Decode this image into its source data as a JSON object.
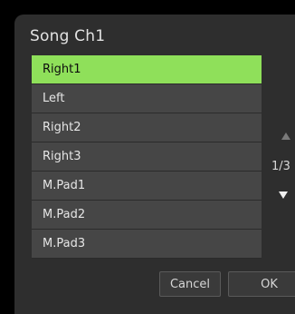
{
  "dialog": {
    "title": "Song Ch1",
    "items": [
      {
        "label": "Right1",
        "selected": true
      },
      {
        "label": "Left",
        "selected": false
      },
      {
        "label": "Right2",
        "selected": false
      },
      {
        "label": "Right3",
        "selected": false
      },
      {
        "label": "M.Pad1",
        "selected": false
      },
      {
        "label": "M.Pad2",
        "selected": false
      },
      {
        "label": "M.Pad3",
        "selected": false
      }
    ],
    "page_indicator": "1/3",
    "cancel_label": "Cancel",
    "ok_label": "OK"
  },
  "colors": {
    "selected_bg": "#8fe05a",
    "item_bg": "#464646",
    "dialog_bg": "#2e2e2e"
  }
}
